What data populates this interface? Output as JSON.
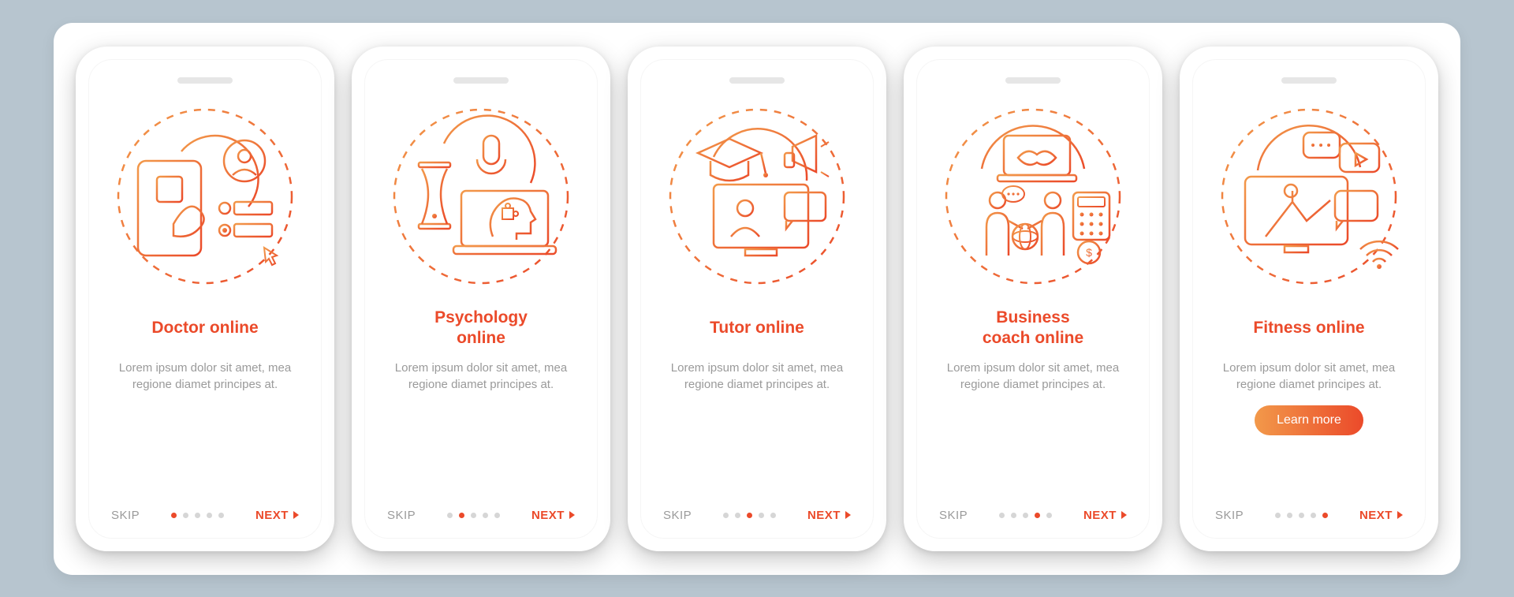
{
  "colors": {
    "accent": "#eb4a2a",
    "gradient_start": "#f2994a",
    "gradient_end": "#eb4a2a",
    "muted": "#9a9a9a",
    "dot_inactive": "#d6d6d6",
    "background": "#b7c5cf"
  },
  "common": {
    "skip_label": "SKIP",
    "next_label": "NEXT",
    "body_text": "Lorem ipsum dolor sit amet, mea regione diamet principes at."
  },
  "learn_more_label": "Learn more",
  "screens": [
    {
      "title": "Doctor online",
      "icon": "doctor-online-icon",
      "active_dot": 0,
      "show_learn_more": false
    },
    {
      "title": "Psychology\nonline",
      "icon": "psychology-online-icon",
      "active_dot": 1,
      "show_learn_more": false
    },
    {
      "title": "Tutor online",
      "icon": "tutor-online-icon",
      "active_dot": 2,
      "show_learn_more": false
    },
    {
      "title": "Business\ncoach online",
      "icon": "business-coach-online-icon",
      "active_dot": 3,
      "show_learn_more": false
    },
    {
      "title": "Fitness online",
      "icon": "fitness-online-icon",
      "active_dot": 4,
      "show_learn_more": true
    }
  ]
}
